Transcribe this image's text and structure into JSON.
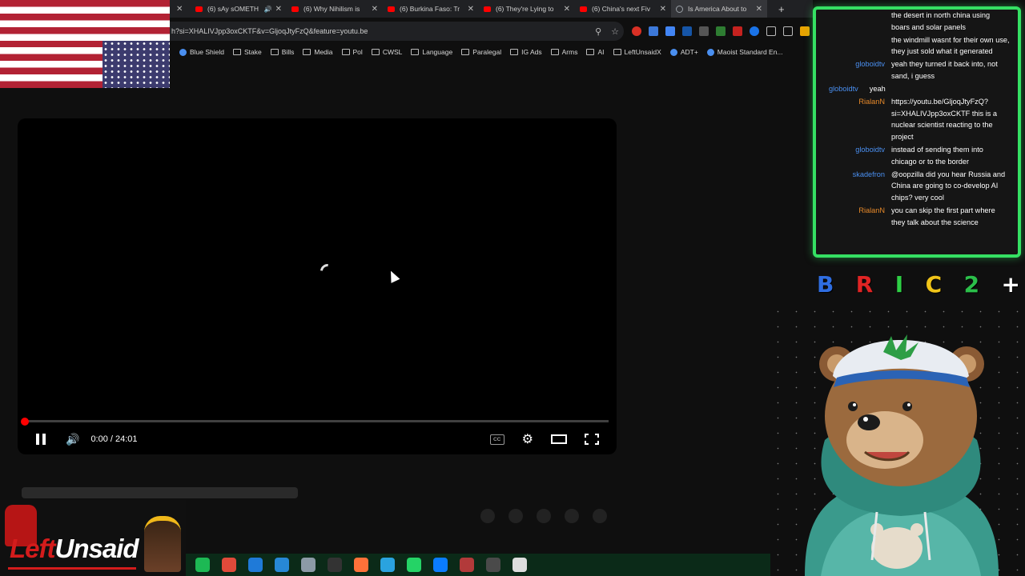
{
  "browser": {
    "tabs": [
      {
        "title": "(6) sAy sOMETH",
        "audio": true,
        "active": false
      },
      {
        "title": "(6) Why Nihilism is",
        "audio": false,
        "active": false
      },
      {
        "title": "(6) Burkina Faso: Tr",
        "audio": false,
        "active": false
      },
      {
        "title": "(6) They're Lying to",
        "audio": false,
        "active": false
      },
      {
        "title": "(6) China's next Fiv",
        "audio": false,
        "active": false
      },
      {
        "title": "Is America About to",
        "audio": false,
        "active": true
      }
    ],
    "url": "h?si=XHALIVJpp3oxCKTF&v=GljoqJtyFzQ&feature=youtu.be",
    "bookmarks": [
      "Blue Shield",
      "Stake",
      "Bills",
      "Media",
      "Pol",
      "CWSL",
      "Language",
      "Paralegal",
      "IG Ads",
      "Arms",
      "AI",
      "LeftUnsaidX",
      "ADT+",
      "Maoist Standard En..."
    ]
  },
  "player": {
    "time": "0:00 / 24:01",
    "progress": 0,
    "cc_label": "CC"
  },
  "logo": {
    "part1": "Left",
    "part2": "Unsaid"
  },
  "chat": {
    "messages": [
      {
        "user": "",
        "text": "the desert in north china using boars and solar panels",
        "color": "#4a8ff0"
      },
      {
        "user": "",
        "text": "the windmill wasnt for their own use, they just sold what it generated",
        "color": "#4a8ff0"
      },
      {
        "user": "globoidtv",
        "text": "yeah they turned it back into, not sand, i guess",
        "color": "#4a8ff0"
      },
      {
        "user": "globoidtv",
        "text": "yeah",
        "color": "#4a8ff0",
        "inline": true
      },
      {
        "user": "RialanN",
        "text": "https://youtu.be/GljoqJtyFzQ?si=XHALIVJpp3oxCKTF this is a nuclear scientist reacting to the project",
        "color": "#e88a2a"
      },
      {
        "user": "globoidtv",
        "text": "instead of sending them into chicago or to the border",
        "color": "#4a8ff0"
      },
      {
        "user": "skadefron",
        "text": "@oopzilla did you hear Russia and China are going to co-develop AI chips? very cool",
        "color": "#4a8ff0"
      },
      {
        "user": "RialanN",
        "text": "you can skip the first part where they talk about the science",
        "color": "#e88a2a"
      }
    ]
  },
  "channels": [
    {
      "glyph": "B",
      "color": "#2f6de0"
    },
    {
      "glyph": "R",
      "color": "#e02424"
    },
    {
      "glyph": "I",
      "color": "#2ecf45"
    },
    {
      "glyph": "C",
      "color": "#f0c419"
    },
    {
      "glyph": "2",
      "color": "#2bbf4a"
    },
    {
      "glyph": "+",
      "color": "#ffffff"
    }
  ],
  "taskbar_icons": [
    {
      "name": "spotify",
      "color": "#1db954"
    },
    {
      "name": "chrome",
      "color": "#e04a3a"
    },
    {
      "name": "store",
      "color": "#1f7ad8"
    },
    {
      "name": "vscode",
      "color": "#2788d6"
    },
    {
      "name": "app5",
      "color": "#8c9aa6"
    },
    {
      "name": "epic",
      "color": "#333333"
    },
    {
      "name": "firefox",
      "color": "#ff7139"
    },
    {
      "name": "telegram",
      "color": "#2aa3df"
    },
    {
      "name": "whatsapp",
      "color": "#25d366"
    },
    {
      "name": "messenger",
      "color": "#0a7cff"
    },
    {
      "name": "app11",
      "color": "#b23a3a"
    },
    {
      "name": "obs",
      "color": "#4a4a4a"
    },
    {
      "name": "app13",
      "color": "#dddddd"
    }
  ],
  "colors": {
    "chat_border": "#35e063",
    "progress": "#ff0000"
  }
}
